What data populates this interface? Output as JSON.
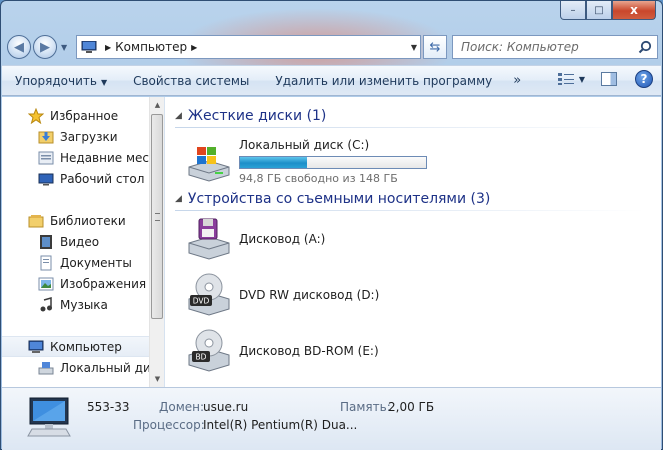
{
  "address": {
    "crumb": "Компьютер"
  },
  "search": {
    "placeholder": "Поиск: Компьютер"
  },
  "toolbar": {
    "organize": "Упорядочить",
    "system_properties": "Свойства системы",
    "uninstall": "Удалить или изменить программу",
    "more": "»"
  },
  "sidebar": {
    "favorites": "Избранное",
    "downloads": "Загрузки",
    "recent": "Недавние места",
    "desktop": "Рабочий стол",
    "libraries": "Библиотеки",
    "video": "Видео",
    "documents": "Документы",
    "pictures": "Изображения",
    "music": "Музыка",
    "computer": "Компьютер",
    "local_disk": "Локальный диск"
  },
  "main": {
    "hdd_group": "Жесткие диски (1)",
    "removable_group": "Устройства со съемными носителями (3)",
    "local_disk": {
      "label": "Локальный диск (C:)",
      "free_text": "94,8 ГБ свободно из 148 ГБ",
      "used_fraction": 0.36
    },
    "floppy": "Дисковод (A:)",
    "dvd": "DVD RW дисковод (D:)",
    "bd": "Дисковод BD-ROM (E:)",
    "dvd_badge": "DVD",
    "bd_badge": "BD"
  },
  "details": {
    "name": "553-33",
    "domain_label": "Домен:",
    "domain_value": "usue.ru",
    "memory_label": "Память:",
    "memory_value": "2,00 ГБ",
    "cpu_label": "Процессор:",
    "cpu_value": "Intel(R) Pentium(R) Dua..."
  },
  "caption": {
    "minimize": "–",
    "maximize": "□",
    "close": "x"
  },
  "icons": {
    "accent": "#1e3287",
    "progress": "#1d8fc9"
  }
}
